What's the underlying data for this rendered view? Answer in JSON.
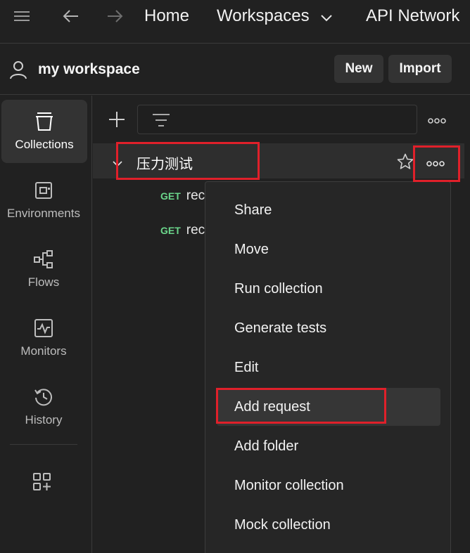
{
  "topbar": {
    "menu_icon": "hamburger-icon",
    "back_icon": "arrow-left-icon",
    "forward_icon": "arrow-right-icon",
    "home": "Home",
    "workspaces": "Workspaces",
    "api_network": "API Network"
  },
  "workspace": {
    "name": "my workspace",
    "new_label": "New",
    "import_label": "Import"
  },
  "rail": {
    "items": [
      {
        "label": "Collections",
        "icon": "collections-icon"
      },
      {
        "label": "Environments",
        "icon": "environments-icon"
      },
      {
        "label": "Flows",
        "icon": "flows-icon"
      },
      {
        "label": "Monitors",
        "icon": "monitors-icon"
      },
      {
        "label": "History",
        "icon": "history-icon"
      }
    ],
    "add_icon": "configure-workbench-icon"
  },
  "collection": {
    "name": "压力测试",
    "requests": [
      {
        "method": "GET",
        "name": "rec"
      },
      {
        "method": "GET",
        "name": "rec"
      }
    ]
  },
  "menu": {
    "items": [
      "Share",
      "Move",
      "Run collection",
      "Generate tests",
      "Edit",
      "Add request",
      "Add folder",
      "Monitor collection",
      "Mock collection"
    ]
  },
  "colors": {
    "background": "#212121",
    "highlight": "#e0202a",
    "get_method": "#6bd68b"
  }
}
